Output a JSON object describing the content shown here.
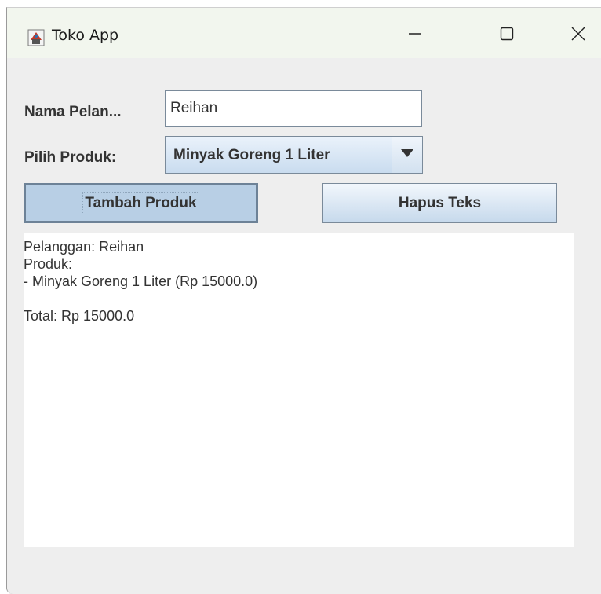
{
  "window": {
    "title": "Toko App",
    "app_icon": "java-app-icon",
    "controls": [
      "minimize-icon",
      "maximize-icon",
      "close-icon"
    ]
  },
  "form": {
    "name_label": "Nama Pelan...",
    "name_value": "Reihan",
    "product_label": "Pilih Produk:",
    "product_selected": "Minyak Goreng 1 Liter"
  },
  "buttons": {
    "add_label": "Tambah Produk",
    "clear_label": "Hapus Teks"
  },
  "output": {
    "lines": [
      "Pelanggan: Reihan",
      "Produk:",
      "- Minyak Goreng 1 Liter (Rp 15000.0)",
      "",
      "Total: Rp 15000.0"
    ]
  },
  "colors": {
    "window_bg": "#eeeeee",
    "titlebar_bg": "#f2f6ee",
    "button_pressed": "#b8cfe5",
    "text": "#333333"
  }
}
